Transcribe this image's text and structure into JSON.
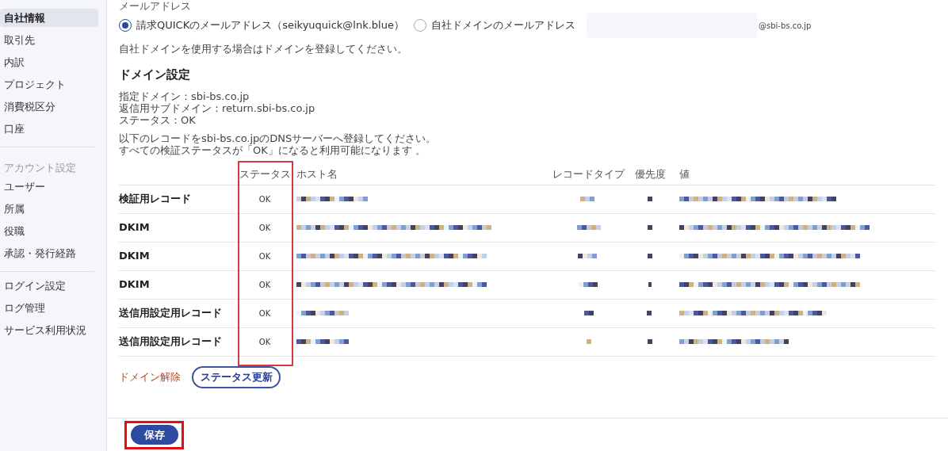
{
  "sidebar": {
    "items": [
      {
        "kind": "item",
        "label": "自社情報",
        "selected": true
      },
      {
        "kind": "item",
        "label": "取引先",
        "selected": false
      },
      {
        "kind": "item",
        "label": "内訳",
        "selected": false
      },
      {
        "kind": "item",
        "label": "プロジェクト",
        "selected": false
      },
      {
        "kind": "item",
        "label": "消費税区分",
        "selected": false
      },
      {
        "kind": "item",
        "label": "口座",
        "selected": false
      },
      {
        "kind": "divider"
      },
      {
        "kind": "heading",
        "label": "アカウント設定"
      },
      {
        "kind": "item",
        "label": "ユーザー",
        "selected": false
      },
      {
        "kind": "item",
        "label": "所属",
        "selected": false
      },
      {
        "kind": "item",
        "label": "役職",
        "selected": false
      },
      {
        "kind": "item",
        "label": "承認・発行経路",
        "selected": false
      },
      {
        "kind": "divider"
      },
      {
        "kind": "item",
        "label": "ログイン設定",
        "selected": false
      },
      {
        "kind": "item",
        "label": "ログ管理",
        "selected": false
      },
      {
        "kind": "item",
        "label": "サービス利用状況",
        "selected": false
      }
    ]
  },
  "email": {
    "label": "メールアドレス",
    "options": [
      {
        "label": "請求QUICKのメールアドレス（seikyuquick@lnk.blue）",
        "selected": true
      },
      {
        "label": "自社ドメインのメールアドレス",
        "selected": false
      }
    ],
    "domain_suffix": "@sbi-bs.co.jp",
    "note": "自社ドメインを使用する場合はドメインを登録してください。"
  },
  "domain_settings": {
    "title": "ドメイン設定",
    "info": [
      "指定ドメイン：sbi-bs.co.jp",
      "返信用サブドメイン：return.sbi-bs.co.jp",
      "ステータス：OK"
    ],
    "instructions": [
      "以下のレコードをsbi-bs.co.jpのDNSサーバーへ登録してください。",
      "すべての検証ステータスが「OK」になると利用可能になります 。"
    ]
  },
  "table": {
    "columns": [
      "ステータス",
      "ホスト名",
      "レコードタイプ",
      "優先度",
      "値"
    ],
    "rows": [
      {
        "label": "検証用レコード",
        "status": "OK"
      },
      {
        "label": "DKIM",
        "status": "OK"
      },
      {
        "label": "DKIM",
        "status": "OK"
      },
      {
        "label": "DKIM",
        "status": "OK"
      },
      {
        "label": "送信用設定用レコード",
        "status": "OK"
      },
      {
        "label": "送信用設定用レコード",
        "status": "OK"
      }
    ]
  },
  "actions": {
    "remove_link": "ドメイン解除",
    "refresh_button": "ステータス更新"
  },
  "footer": {
    "save_button": "保存"
  }
}
